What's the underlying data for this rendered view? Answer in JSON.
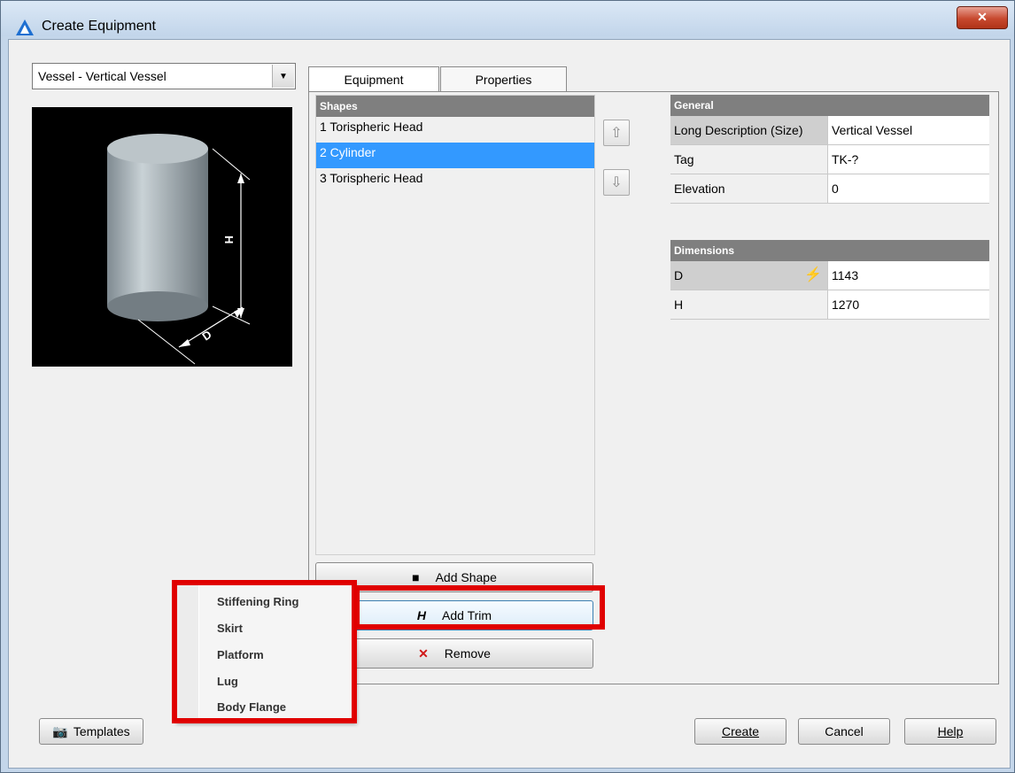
{
  "window": {
    "title": "Create Equipment",
    "close_label": "✕"
  },
  "equipment_type": {
    "value": "Vessel - Vertical Vessel"
  },
  "tabs": [
    {
      "label": "Equipment"
    },
    {
      "label": "Properties"
    }
  ],
  "shapes": {
    "header": "Shapes",
    "items": [
      "1 Torispheric Head",
      "2 Cylinder",
      "3 Torispheric Head"
    ],
    "selected_index": 1
  },
  "preview": {
    "height_label": "H",
    "diameter_label": "D"
  },
  "general": {
    "header": "General",
    "rows": [
      {
        "key": "Long Description (Size)",
        "value": "Vertical Vessel"
      },
      {
        "key": "Tag",
        "value": "TK-?"
      },
      {
        "key": "Elevation",
        "value": "0"
      }
    ]
  },
  "dimensions": {
    "header": "Dimensions",
    "rows": [
      {
        "key": "D",
        "value": "1143"
      },
      {
        "key": "H",
        "value": "1270"
      }
    ]
  },
  "actions": {
    "add_shape": "Add Shape",
    "add_trim": "Add Trim",
    "remove": "Remove"
  },
  "trim_menu": [
    "Stiffening Ring",
    "Skirt",
    "Platform",
    "Lug",
    "Body Flange"
  ],
  "footer": {
    "templates": "Templates",
    "create": "Create",
    "cancel": "Cancel",
    "help": "Help"
  },
  "colors": {
    "selection": "#3399ff",
    "highlight": "#e00000",
    "header_gray": "#7f7f7f"
  }
}
